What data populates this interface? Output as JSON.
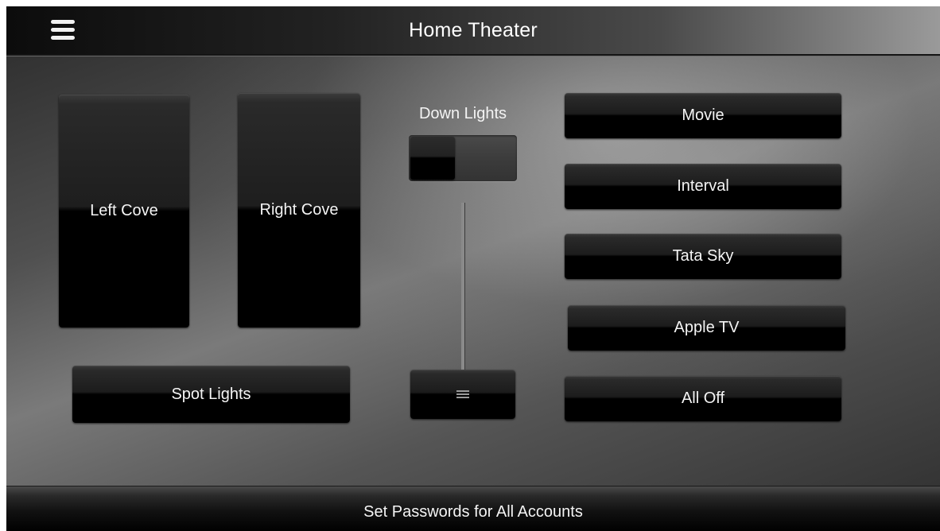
{
  "header": {
    "title": "Home Theater",
    "menu_icon": "hamburger-menu-icon"
  },
  "lights": {
    "left_cove": "Left Cove",
    "right_cove": "Right Cove",
    "spot_lights": "Spot Lights",
    "down_lights_label": "Down Lights",
    "down_lights_toggle_state": "off",
    "down_lights_dim_level": 0,
    "slider_grip_icon": "grip-lines-icon"
  },
  "scenes": {
    "movie": "Movie",
    "interval": "Interval",
    "tata_sky": "Tata Sky",
    "apple_tv": "Apple TV",
    "all_off": "All Off"
  },
  "footer": {
    "label": "Set Passwords for All Accounts"
  }
}
